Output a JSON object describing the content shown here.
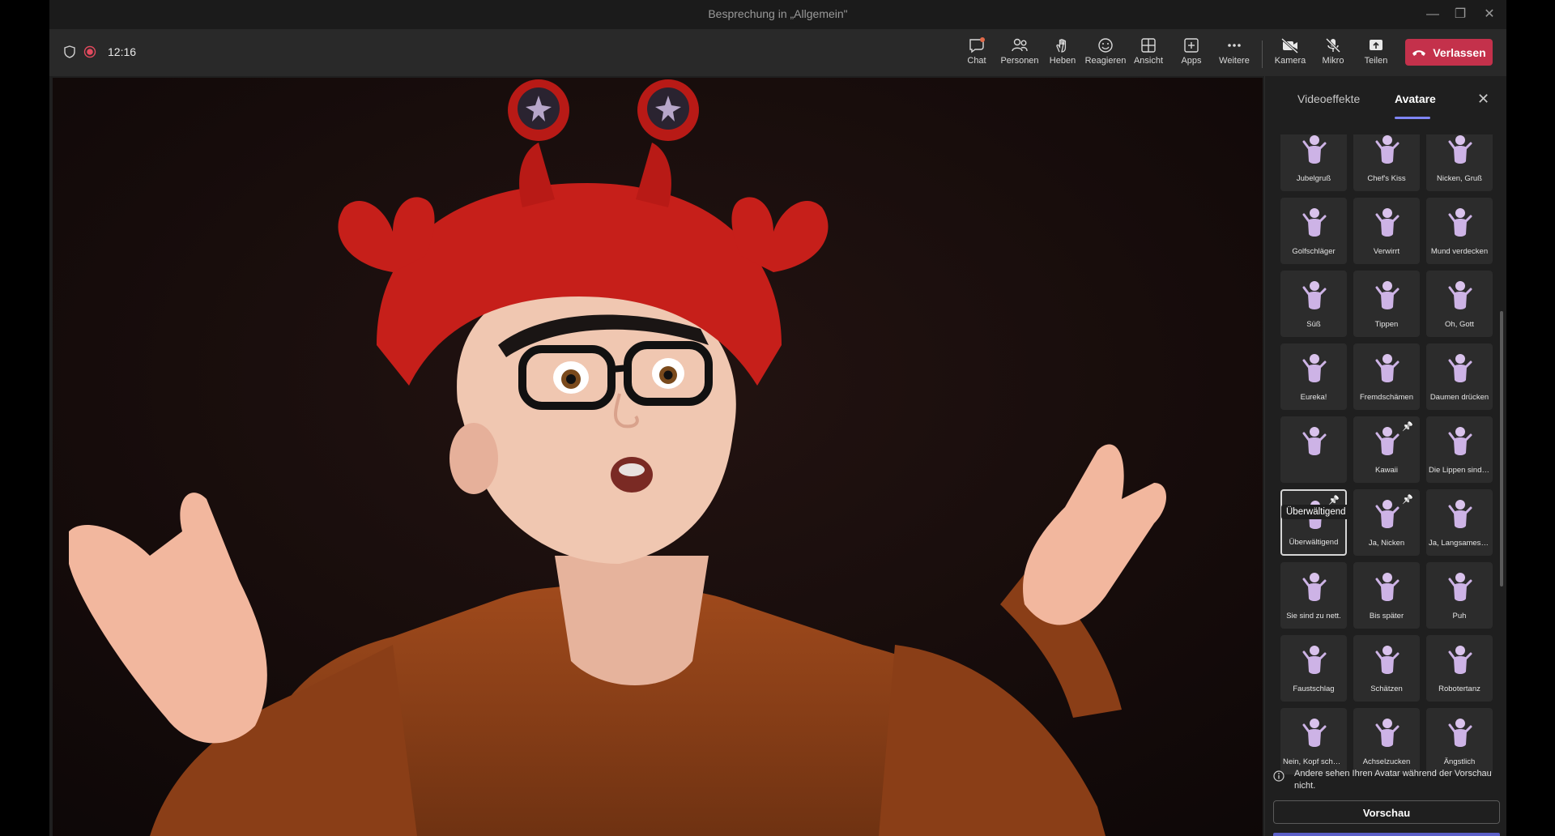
{
  "window": {
    "title": "Besprechung in „Allgemein\""
  },
  "meeting": {
    "time": "12:16"
  },
  "toolbar": {
    "buttons": [
      {
        "label": "Chat",
        "icon": "chat-icon"
      },
      {
        "label": "Personen",
        "icon": "people-icon"
      },
      {
        "label": "Heben",
        "icon": "raise-hand-icon"
      },
      {
        "label": "Reagieren",
        "icon": "react-icon"
      },
      {
        "label": "Ansicht",
        "icon": "view-icon"
      },
      {
        "label": "Apps",
        "icon": "apps-icon"
      },
      {
        "label": "Weitere",
        "icon": "more-icon"
      },
      {
        "label": "Kamera",
        "icon": "camera-off-icon"
      },
      {
        "label": "Mikro",
        "icon": "mic-off-icon"
      },
      {
        "label": "Teilen",
        "icon": "share-icon"
      }
    ],
    "leave_label": "Verlassen"
  },
  "panel": {
    "tabs": {
      "video_effects": "Videoeffekte",
      "avatars": "Avatare"
    },
    "tooltip": "Überwältigend",
    "tiles": [
      {
        "label": "Jubelgruß"
      },
      {
        "label": "Chef's Kiss"
      },
      {
        "label": "Nicken, Gruß"
      },
      {
        "label": "Golfschläger"
      },
      {
        "label": "Verwirrt"
      },
      {
        "label": "Mund verdecken"
      },
      {
        "label": "Süß"
      },
      {
        "label": "Tippen"
      },
      {
        "label": "Oh, Gott"
      },
      {
        "label": "Eureka!"
      },
      {
        "label": "Fremdschämen"
      },
      {
        "label": "Daumen drücken"
      },
      {
        "label": ""
      },
      {
        "label": "Kawaii"
      },
      {
        "label": "Die Lippen sind ..."
      },
      {
        "label": "Überwältigend"
      },
      {
        "label": "Ja, Nicken"
      },
      {
        "label": "Ja, Langsames N..."
      },
      {
        "label": "Sie sind zu nett."
      },
      {
        "label": "Bis später"
      },
      {
        "label": "Puh"
      },
      {
        "label": "Faustschlag"
      },
      {
        "label": "Schätzen"
      },
      {
        "label": "Robotertanz"
      },
      {
        "label": "Nein, Kopf schüt..."
      },
      {
        "label": "Achselzucken"
      },
      {
        "label": "Ängstlich"
      }
    ],
    "info_text": "Andere sehen Ihren Avatar während der Vorschau nicht.",
    "preview_label": "Vorschau"
  },
  "colors": {
    "leave": "#c4314b",
    "accent": "#7f85f5",
    "brand": "#5b5fc7"
  }
}
